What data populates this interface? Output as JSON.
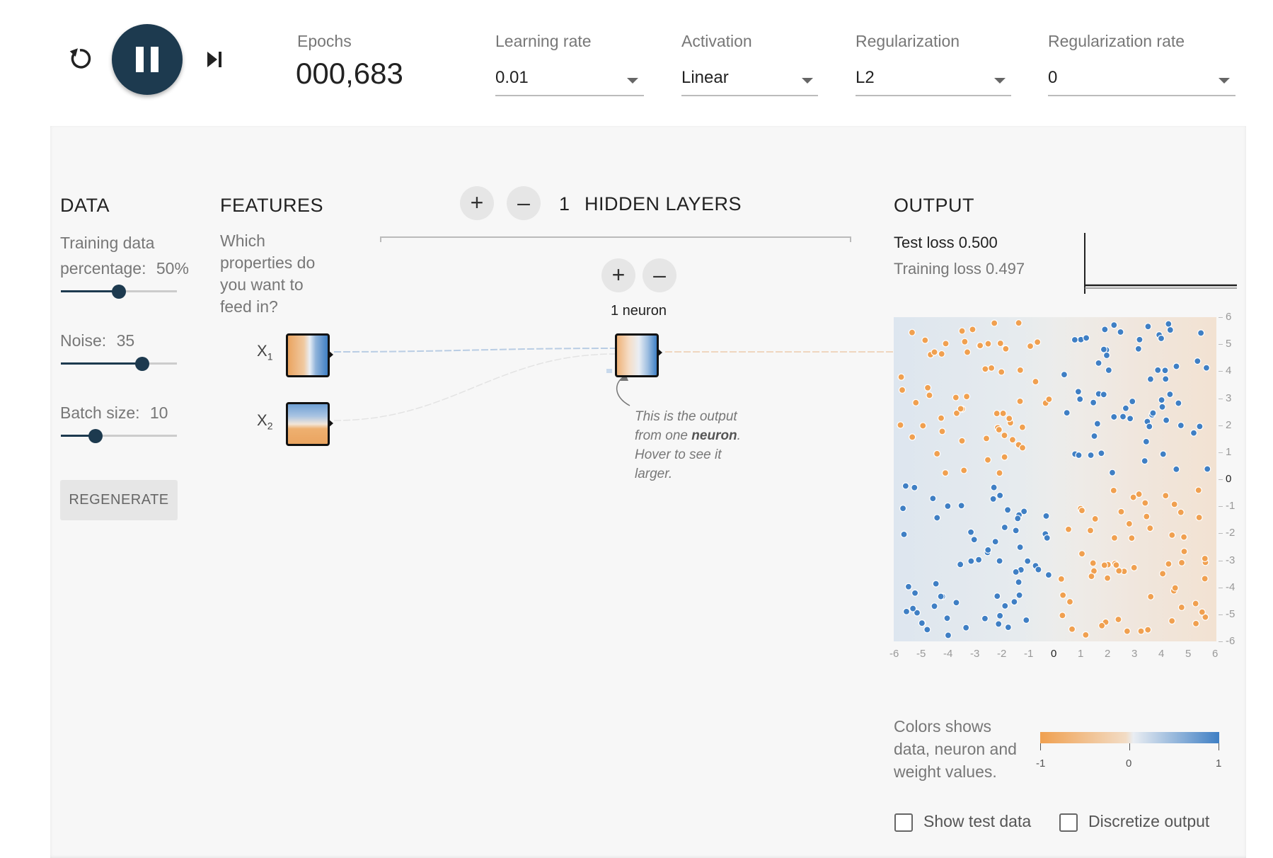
{
  "header": {
    "epochs_label": "Epochs",
    "epochs_value": "000,683",
    "learning_rate": {
      "label": "Learning rate",
      "value": "0.01"
    },
    "activation": {
      "label": "Activation",
      "value": "Linear"
    },
    "regularization": {
      "label": "Regularization",
      "value": "L2"
    },
    "regularization_rate": {
      "label": "Regularization rate",
      "value": "0"
    }
  },
  "data_panel": {
    "title": "DATA",
    "training_label_1": "Training data",
    "training_label_2": "percentage:",
    "training_value": "50%",
    "training_fraction": 0.5,
    "noise_label": "Noise:",
    "noise_value": "35",
    "noise_fraction": 0.7,
    "batch_label": "Batch size:",
    "batch_value": "10",
    "batch_fraction": 0.3,
    "regenerate": "REGENERATE"
  },
  "features_panel": {
    "title": "FEATURES",
    "desc": [
      "Which",
      "properties do",
      "you want to",
      "feed in?"
    ],
    "x1_label": "X",
    "x1_sub": "1",
    "x2_label": "X",
    "x2_sub": "2"
  },
  "hidden": {
    "plus": "+",
    "minus": "–",
    "count": "1",
    "title": "HIDDEN LAYERS",
    "neuron_label": "1 neuron",
    "annotation_lines": [
      "This is the output",
      "from one ",
      "neuron",
      ".",
      "Hover to see it",
      "larger."
    ]
  },
  "output": {
    "title": "OUTPUT",
    "test_loss": "Test loss 0.500",
    "training_loss": "Training loss 0.497",
    "y_ticks": [
      "6",
      "5",
      "4",
      "3",
      "2",
      "1",
      "0",
      "-1",
      "-2",
      "-3",
      "-4",
      "-5",
      "-6"
    ],
    "x_ticks": [
      "-6",
      "-5",
      "-4",
      "-3",
      "-2",
      "-1",
      "0",
      "1",
      "2",
      "3",
      "4",
      "5",
      "6"
    ],
    "legend_text": [
      "Colors shows",
      "data, neuron and",
      "weight values."
    ],
    "legend_ticks": [
      "-1",
      "0",
      "1"
    ],
    "show_test_data": "Show test data",
    "discretize_output": "Discretize output"
  },
  "colors": {
    "orange": "#f0a050",
    "blue": "#3f7fc4",
    "dark": "#1d3a4f"
  }
}
